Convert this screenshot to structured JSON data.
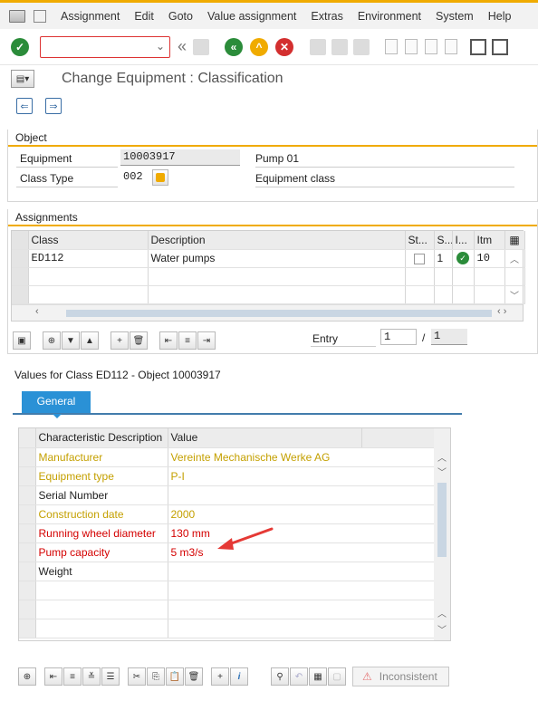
{
  "menu": {
    "items": [
      "Assignment",
      "Edit",
      "Goto",
      "Value assignment",
      "Extras",
      "Environment",
      "System",
      "Help"
    ]
  },
  "toolbar": {
    "command_value": "",
    "icons": [
      "enter-icon",
      "back-icon",
      "save-icon",
      "back-green-icon",
      "exit-icon",
      "cancel-icon",
      "print-icon",
      "find-icon",
      "find-next-icon",
      "first-page-icon",
      "prev-page-icon",
      "next-page-icon",
      "last-page-icon",
      "create-session-icon",
      "shortcut-icon"
    ]
  },
  "title": "Change Equipment : Classification",
  "object": {
    "header": "Object",
    "equipment_label": "Equipment",
    "equipment_value": "10003917",
    "equipment_desc": "Pump 01",
    "class_type_label": "Class Type",
    "class_type_value": "002",
    "class_type_desc": "Equipment class"
  },
  "assignments": {
    "header": "Assignments",
    "columns": [
      "Class",
      "Description",
      "St...",
      "S...",
      "I...",
      "Itm"
    ],
    "rows": [
      {
        "class": "ED112",
        "description": "Water pumps",
        "s": "1",
        "itm": "10"
      }
    ],
    "entry_label": "Entry",
    "entry_value": "1",
    "entry_sep": "/",
    "entry_total": "1"
  },
  "values": {
    "title": "Values for Class ED112 - Object 10003917",
    "tab": "General",
    "columns": [
      "Characteristic Description",
      "Value"
    ],
    "rows": [
      {
        "desc": "Manufacturer",
        "value": "Vereinte Mechanische Werke AG",
        "color": "#c4a000"
      },
      {
        "desc": "Equipment type",
        "value": "P-I",
        "color": "#c4a000"
      },
      {
        "desc": "Serial Number",
        "value": "",
        "color": "#222222"
      },
      {
        "desc": "Construction date",
        "value": "2000",
        "color": "#c4a000"
      },
      {
        "desc": "Running wheel diameter",
        "value": "130 mm",
        "color": "#d40000"
      },
      {
        "desc": "Pump capacity",
        "value": "5 m3/s",
        "color": "#d40000"
      },
      {
        "desc": "Weight",
        "value": "",
        "color": "#222222"
      }
    ],
    "inconsistent_label": "Inconsistent"
  },
  "colors": {
    "accent": "#f0ab00",
    "tab": "#2a91d6",
    "ok": "#2b8c3a",
    "arrow": "#e53935"
  }
}
